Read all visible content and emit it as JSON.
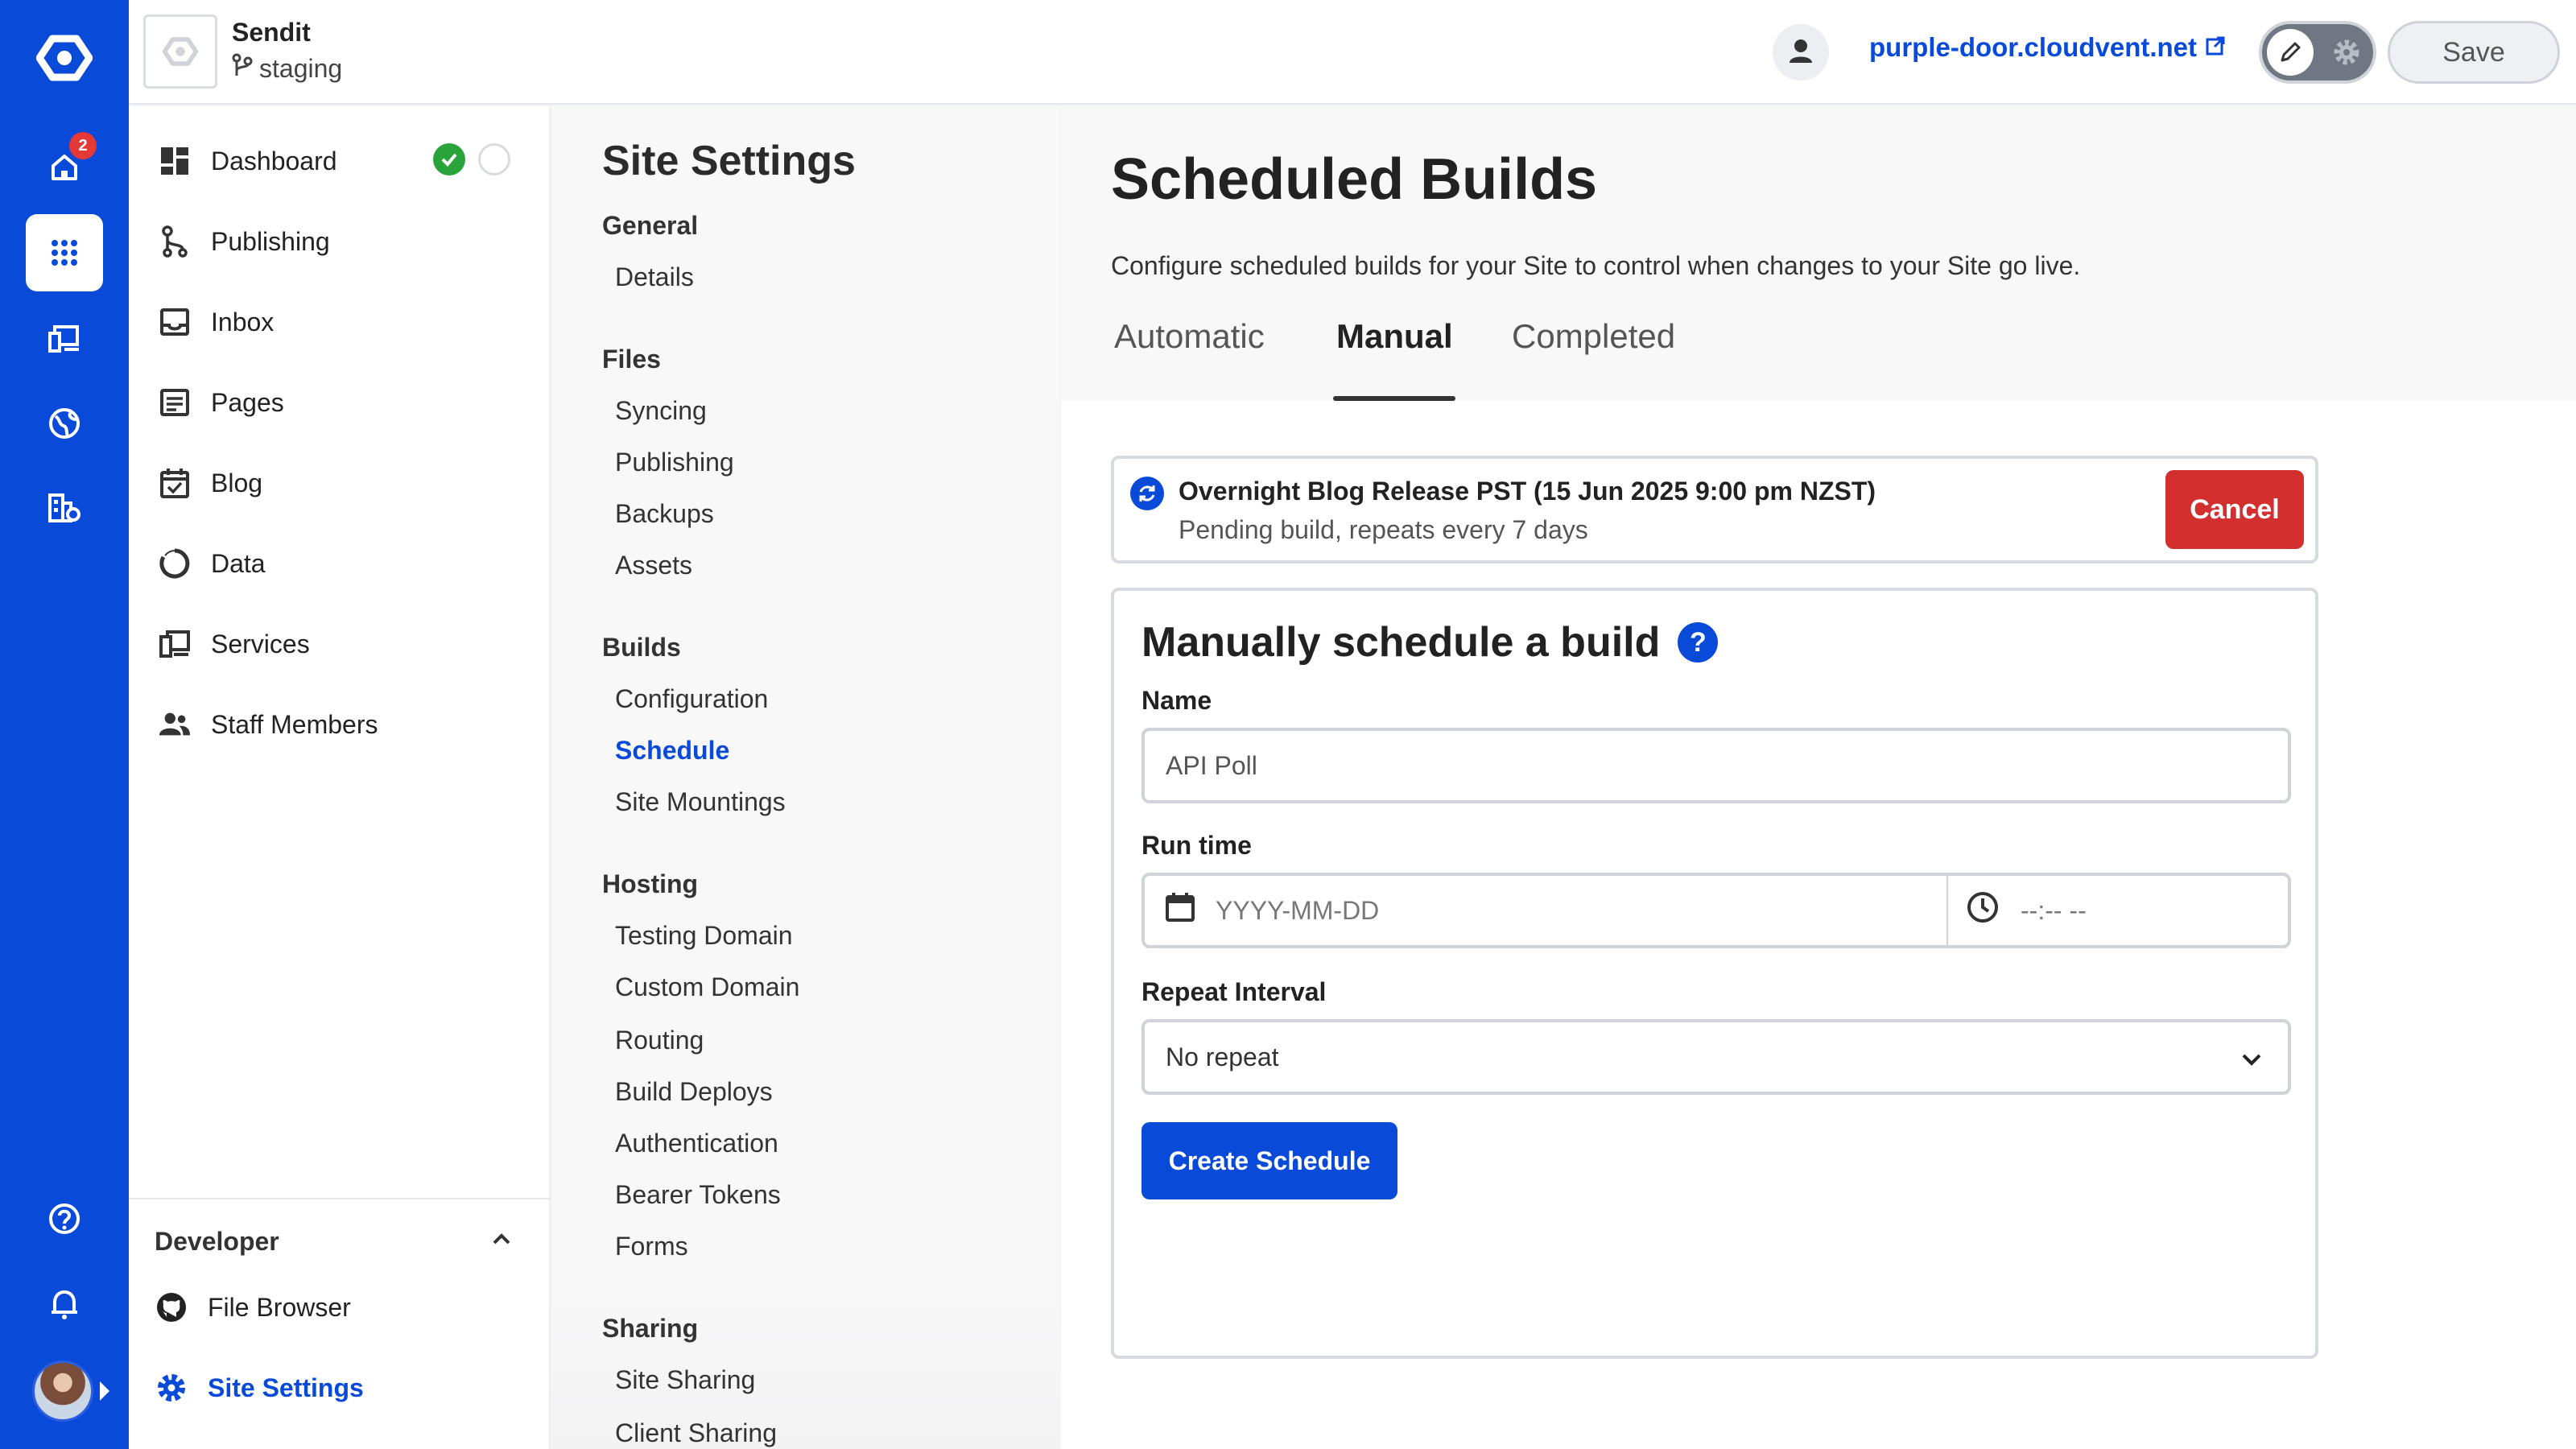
{
  "rail": {
    "badge_count": "2",
    "accent": "#0a4ad9"
  },
  "header": {
    "site_name": "Sendit",
    "branch": "staging",
    "site_url": "purple-door.cloudvent.net",
    "save_label": "Save"
  },
  "nav": {
    "items": [
      {
        "label": "Dashboard",
        "icon": "dashboard-icon"
      },
      {
        "label": "Publishing",
        "icon": "branch-icon"
      },
      {
        "label": "Inbox",
        "icon": "inbox-icon"
      },
      {
        "label": "Pages",
        "icon": "pages-icon"
      },
      {
        "label": "Blog",
        "icon": "blog-icon"
      },
      {
        "label": "Data",
        "icon": "data-icon"
      },
      {
        "label": "Services",
        "icon": "services-icon"
      },
      {
        "label": "Staff Members",
        "icon": "people-icon"
      }
    ],
    "developer": {
      "title": "Developer",
      "items": [
        {
          "label": "File Browser",
          "icon": "github-icon"
        },
        {
          "label": "Site Settings",
          "icon": "gear-icon"
        }
      ]
    }
  },
  "settings": {
    "title": "Site Settings",
    "groups": [
      {
        "title": "General",
        "links": [
          "Details"
        ]
      },
      {
        "title": "Files",
        "links": [
          "Syncing",
          "Publishing",
          "Backups",
          "Assets"
        ]
      },
      {
        "title": "Builds",
        "links": [
          "Configuration",
          "Schedule",
          "Site Mountings"
        ]
      },
      {
        "title": "Hosting",
        "links": [
          "Testing Domain",
          "Custom Domain",
          "Routing",
          "Build Deploys",
          "Authentication",
          "Bearer Tokens",
          "Forms"
        ]
      },
      {
        "title": "Sharing",
        "links": [
          "Site Sharing",
          "Client Sharing"
        ]
      }
    ],
    "active_link": "Schedule"
  },
  "main": {
    "title": "Scheduled Builds",
    "subtitle": "Configure scheduled builds for your Site to control when changes to your Site go live.",
    "tabs": [
      "Automatic",
      "Manual",
      "Completed"
    ],
    "active_tab": "Manual",
    "pending": {
      "title": "Overnight Blog Release PST (15 Jun 2025 9:00 pm NZST)",
      "subtitle": "Pending build, repeats every 7 days",
      "cancel_label": "Cancel"
    },
    "form": {
      "title": "Manually schedule a build",
      "name_label": "Name",
      "name_placeholder": "API Poll",
      "runtime_label": "Run time",
      "date_placeholder": "YYYY-MM-DD",
      "time_placeholder": "--:-- --",
      "repeat_label": "Repeat Interval",
      "repeat_value": "No repeat",
      "submit_label": "Create Schedule"
    }
  }
}
